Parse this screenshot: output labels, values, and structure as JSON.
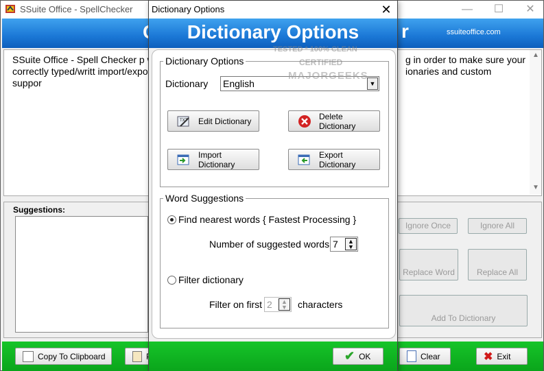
{
  "main": {
    "title": "SSuite Office - SpellChecker",
    "banner_left": "C",
    "banner_right": "r",
    "site": "ssuiteoffice.com",
    "desc_left": "SSuite Office - Spell Checker p words are correctly typed/writt import/export dictionary suppor",
    "desc_right": "g in order to make sure your ionaries and custom",
    "suggestions_label": "Suggestions:",
    "buttons": {
      "ignore_once": "Ignore Once",
      "ignore_all": "Ignore All",
      "replace_word": "Replace Word",
      "replace_all": "Replace All",
      "add_to_dictionary": "Add To Dictionary",
      "copy_to_clipboard": "Copy To Clipboard",
      "paste_partial": "P",
      "clear": "Clear",
      "exit": "Exit"
    }
  },
  "dialog": {
    "title": "Dictionary Options",
    "banner": "Dictionary Options",
    "group1": "Dictionary Options",
    "dictionary_label": "Dictionary",
    "dictionary_value": "English",
    "edit": "Edit Dictionary",
    "delete": "Delete Dictionary",
    "import": "Import Dictionary",
    "export": "Export Dictionary",
    "group2": "Word Suggestions",
    "radio_nearest": "Find nearest words  { Fastest Processing }",
    "suggested_label": "Number of suggested words",
    "suggested_value": "7",
    "radio_filter": "Filter dictionary",
    "filter_label": "Filter on first",
    "filter_value": "2",
    "filter_suffix": "characters",
    "ok": "OK"
  },
  "watermark": {
    "line1": "TESTED * 100% CLEAN",
    "line2": "CERTIFIED",
    "line3": "MAJORGEEKS"
  }
}
